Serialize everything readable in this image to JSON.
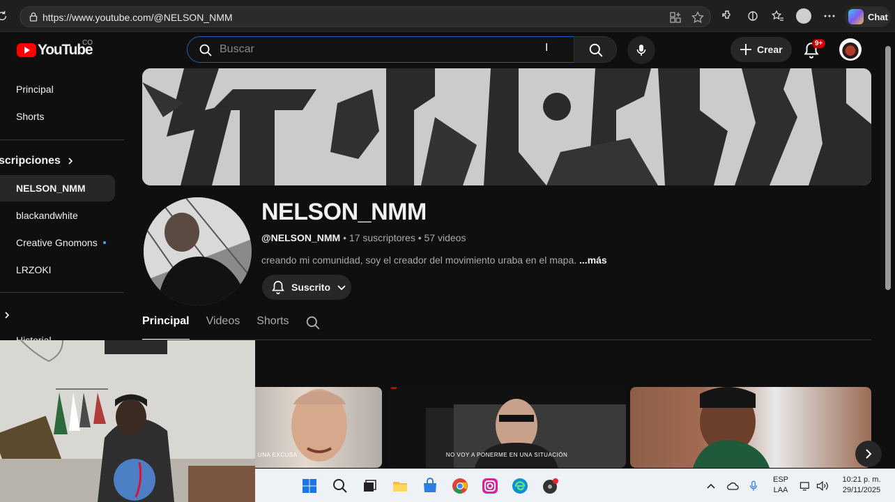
{
  "browser": {
    "url": "https://www.youtube.com/@NELSON_NMM",
    "chat_label": "Chat",
    "icons": [
      "reload-icon",
      "lock-icon",
      "app-available-icon",
      "favorite-star-icon",
      "extensions-icon",
      "split-screen-icon",
      "favorites-icon",
      "profile-icon",
      "more-icon"
    ]
  },
  "header": {
    "logo_text": "YouTube",
    "country_code": "CO",
    "search_placeholder": "Buscar",
    "create_label": "Crear",
    "notification_badge": "9+"
  },
  "sidebar": {
    "items": [
      {
        "label": "Principal"
      },
      {
        "label": "Shorts"
      }
    ],
    "subscriptions_heading": "scripciones",
    "subscriptions": [
      {
        "label": "NELSON_NMM",
        "active": true
      },
      {
        "label": "blackandwhite"
      },
      {
        "label": "Creative Gnomons",
        "new_content": true
      },
      {
        "label": "LRZOKI"
      }
    ],
    "partial_item": "Historial"
  },
  "channel": {
    "name": "NELSON_NMM",
    "handle": "@NELSON_NMM",
    "subscribers": "17 suscriptores",
    "videos_count": "57 videos",
    "separator": "•",
    "description": "creando mi comunidad, soy el creador del movimiento uraba en el mapa.",
    "more_label": "...más",
    "subscribe_label": "Suscrito"
  },
  "tabs": [
    {
      "label": "Principal",
      "active": true
    },
    {
      "label": "Videos"
    },
    {
      "label": "Shorts"
    }
  ],
  "thumbnails": [
    {
      "caption": "UNA EXCUSA"
    },
    {
      "caption": "NO VOY A PONERME EN UNA SITUACIÓN"
    },
    {
      "caption": ""
    }
  ],
  "taskbar": {
    "apps": [
      "windows-start-icon",
      "search-icon",
      "task-view-icon",
      "file-explorer-icon",
      "store-icon",
      "chrome-icon",
      "instagram-icon",
      "edge-icon",
      "app-icon"
    ],
    "language_top": "ESP",
    "language_bottom": "LAA",
    "time": "10:21 p. m.",
    "date": "29/11/2025"
  },
  "colors": {
    "background": "#0f0f0f",
    "youtube_red": "#ff0000",
    "link_blue": "#3ea6ff",
    "search_focus": "#1c62b9"
  }
}
